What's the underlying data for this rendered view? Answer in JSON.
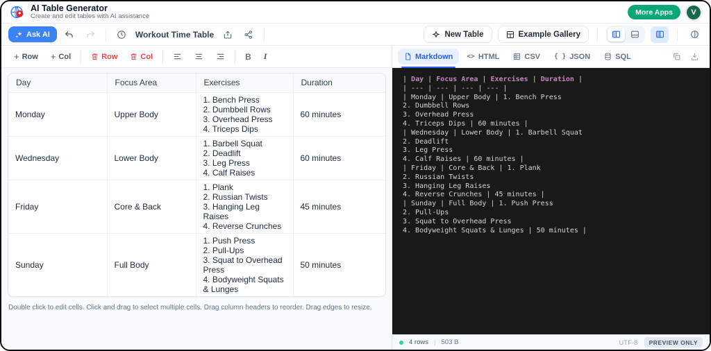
{
  "header": {
    "title": "AI Table Generator",
    "subtitle": "Create and edit tables with AI assistance",
    "more_apps_label": "More Apps",
    "avatar_letter": "V"
  },
  "toolbar": {
    "ask_ai_label": "Ask AI",
    "table_name": "Workout Time Table",
    "new_table_label": "New Table",
    "example_gallery_label": "Example Gallery"
  },
  "table_toolbar": {
    "add_row_label": "Row",
    "add_col_label": "Col",
    "delete_row_label": "Row",
    "delete_col_label": "Col",
    "bold_label": "B",
    "italic_label": "I"
  },
  "table": {
    "columns": [
      "Day",
      "Focus Area",
      "Exercises",
      "Duration"
    ],
    "rows": [
      {
        "cells": [
          "Monday",
          "Upper Body",
          [
            "1. Bench Press",
            "2. Dumbbell Rows",
            "3. Overhead Press",
            "4. Triceps Dips"
          ],
          "60 minutes"
        ]
      },
      {
        "cells": [
          "Wednesday",
          "Lower Body",
          [
            "1. Barbell Squat",
            "2. Deadlift",
            "3. Leg Press",
            "4. Calf Raises"
          ],
          "60 minutes"
        ]
      },
      {
        "cells": [
          "Friday",
          "Core & Back",
          [
            "1. Plank",
            "2. Russian Twists",
            "3. Hanging Leg Raises",
            "4. Reverse Crunches"
          ],
          "45 minutes"
        ]
      },
      {
        "cells": [
          "Sunday",
          "Full Body",
          [
            "1. Push Press",
            "2. Pull-Ups",
            "3. Squat to Overhead Press",
            "4. Bodyweight Squats & Lunges"
          ],
          "50 minutes"
        ]
      }
    ],
    "hint": "Double click to edit cells. Click and drag to select multiple cells. Drag column headers to reorder. Drag edges to resize."
  },
  "export_panel": {
    "tabs": [
      {
        "label": "Markdown",
        "icon": "file",
        "active": true
      },
      {
        "label": "HTML",
        "icon": "code",
        "active": false
      },
      {
        "label": "CSV",
        "icon": "grid",
        "active": false
      },
      {
        "label": "JSON",
        "icon": "braces",
        "active": false
      },
      {
        "label": "SQL",
        "icon": "database",
        "active": false
      }
    ],
    "code_lines": [
      "| Day | Focus Area | Exercises | Duration |",
      "| --- | --- | --- | --- |",
      "| Monday | Upper Body | 1. Bench Press",
      "2. Dumbbell Rows",
      "3. Overhead Press",
      "4. Triceps Dips | 60 minutes |",
      "| Wednesday | Lower Body | 1. Barbell Squat",
      "2. Deadlift",
      "3. Leg Press",
      "4. Calf Raises | 60 minutes |",
      "| Friday | Core & Back | 1. Plank",
      "2. Russian Twists",
      "3. Hanging Leg Raises",
      "4. Reverse Crunches | 45 minutes |",
      "| Sunday | Full Body | 1. Push Press",
      "2. Pull-Ups",
      "3. Squat to Overhead Press",
      "4. Bodyweight Squats & Lunges | 50 minutes |"
    ],
    "status": {
      "row_count": "4 rows",
      "file_size": "503 B",
      "encoding": "UTF-8",
      "badge": "PREVIEW ONLY"
    }
  },
  "colors": {
    "accent_blue": "#3b82f6",
    "danger_red": "#ef4444",
    "brand_green": "#0ca678",
    "code_keyword": "#c586c0",
    "code_background": "#191919"
  }
}
